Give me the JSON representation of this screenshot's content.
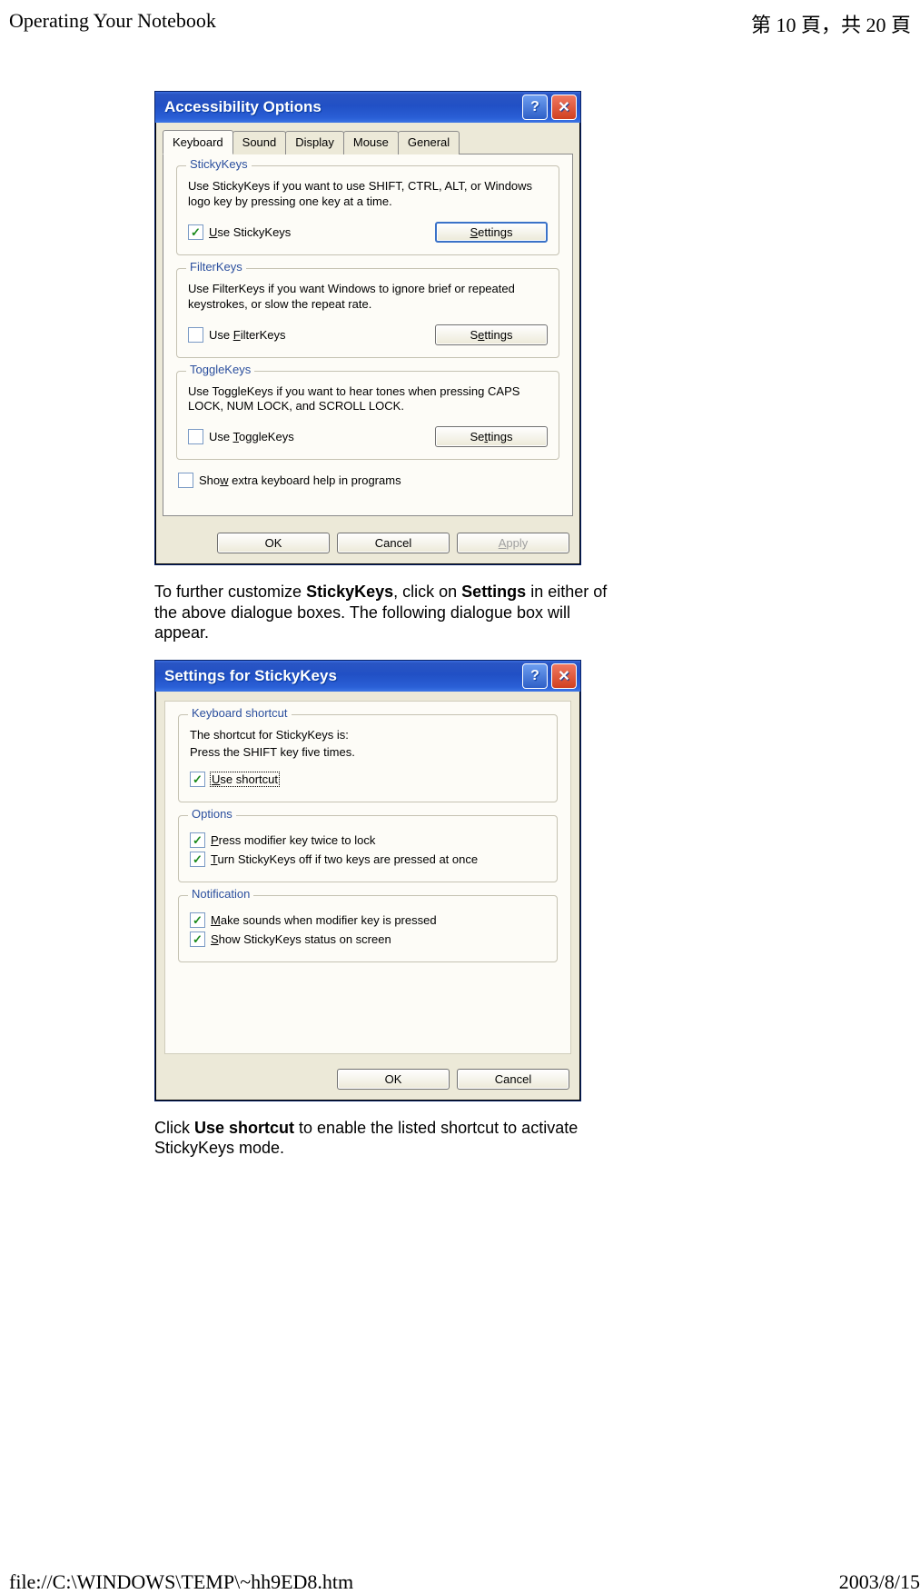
{
  "header": {
    "left": "Operating Your Notebook",
    "right": "第 10 頁，共 20 頁"
  },
  "footer": {
    "left": "file://C:\\WINDOWS\\TEMP\\~hh9ED8.htm",
    "right": "2003/8/15"
  },
  "para1_a": "To further customize ",
  "para1_b": "StickyKeys",
  "para1_c": ", click on ",
  "para1_d": "Settings",
  "para1_e": " in either of the above dialogue boxes. The following dialogue box will appear.",
  "para2_a": "Click ",
  "para2_b": "Use shortcut",
  "para2_c": " to enable the listed shortcut to activate StickyKeys mode.",
  "dlg1": {
    "title": "Accessibility Options",
    "tabs": [
      "Keyboard",
      "Sound",
      "Display",
      "Mouse",
      "General"
    ],
    "sticky": {
      "legend": "StickyKeys",
      "desc": "Use StickyKeys if you want to use SHIFT, CTRL, ALT, or Windows logo key by pressing one key at a time.",
      "checkbox_pre": "U",
      "checkbox_post": "se StickyKeys",
      "settings_pre": "S",
      "settings_post": "ettings"
    },
    "filter": {
      "legend": "FilterKeys",
      "desc": "Use FilterKeys if you want Windows to ignore brief or repeated keystrokes, or slow the repeat rate.",
      "checkbox_pre": "Use ",
      "checkbox_u": "F",
      "checkbox_post": "ilterKeys",
      "settings_pre": "S",
      "settings_u": "e",
      "settings_post": "ttings"
    },
    "toggle": {
      "legend": "ToggleKeys",
      "desc": "Use ToggleKeys if you want to hear tones when pressing CAPS LOCK, NUM LOCK, and SCROLL LOCK.",
      "checkbox_pre": "Use ",
      "checkbox_u": "T",
      "checkbox_post": "oggleKeys",
      "settings_pre": "Se",
      "settings_u": "t",
      "settings_post": "tings"
    },
    "extra_pre": "Sho",
    "extra_u": "w",
    "extra_post": " extra keyboard help in programs",
    "ok": "OK",
    "cancel": "Cancel",
    "apply_pre": "A",
    "apply_post": "pply"
  },
  "dlg2": {
    "title": "Settings for StickyKeys",
    "shortcut": {
      "legend": "Keyboard shortcut",
      "desc1": "The shortcut for StickyKeys is:",
      "desc2": "Press the SHIFT key five times.",
      "cb_u": "U",
      "cb_post": "se shortcut"
    },
    "options": {
      "legend": "Options",
      "cb1_u": "P",
      "cb1_post": "ress modifier key twice to lock",
      "cb2_u": "T",
      "cb2_post": "urn StickyKeys off if two keys are pressed at once"
    },
    "notif": {
      "legend": "Notification",
      "cb1_u": "M",
      "cb1_post": "ake sounds when modifier key is pressed",
      "cb2_u": "S",
      "cb2_post": "how StickyKeys status on screen"
    },
    "ok": "OK",
    "cancel": "Cancel"
  }
}
